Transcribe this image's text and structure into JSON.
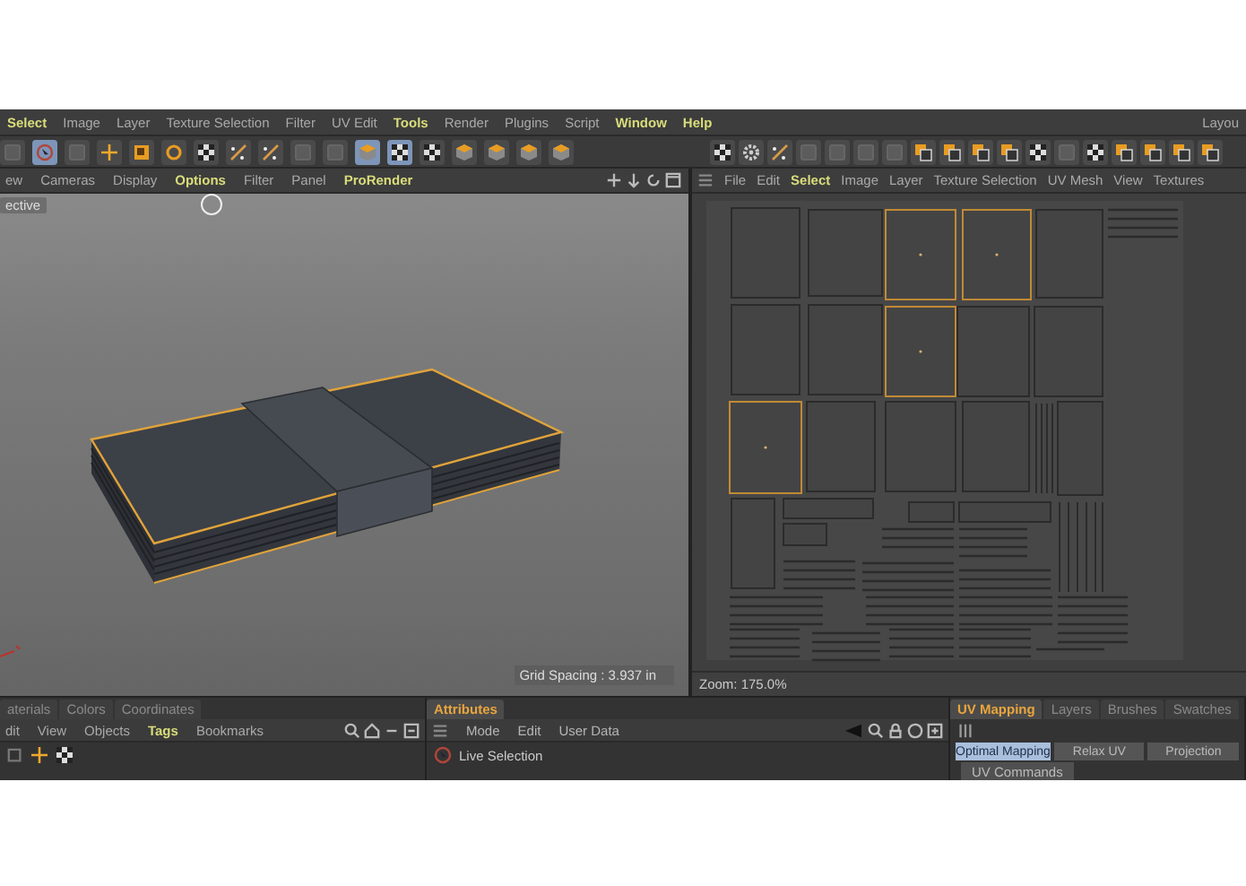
{
  "menu_bar": {
    "items": [
      {
        "label": "Select",
        "highlighted": true
      },
      {
        "label": "Image",
        "highlighted": false
      },
      {
        "label": "Layer",
        "highlighted": false
      },
      {
        "label": "Texture Selection",
        "highlighted": false
      },
      {
        "label": "Filter",
        "highlighted": false
      },
      {
        "label": "UV Edit",
        "highlighted": false
      },
      {
        "label": "Tools",
        "highlighted": true
      },
      {
        "label": "Render",
        "highlighted": false
      },
      {
        "label": "Plugins",
        "highlighted": false
      },
      {
        "label": "Script",
        "highlighted": false
      },
      {
        "label": "Window",
        "highlighted": true
      },
      {
        "label": "Help",
        "highlighted": true
      }
    ],
    "layout_label": "Layou"
  },
  "toolbar": {
    "left": [
      {
        "kind": "grey",
        "active": false
      },
      {
        "kind": "cursor",
        "active": true
      },
      {
        "kind": "grey",
        "active": false
      },
      {
        "kind": "plus",
        "active": false
      },
      {
        "kind": "scale",
        "active": false
      },
      {
        "kind": "rotate",
        "active": false
      },
      {
        "kind": "checker",
        "active": false
      },
      {
        "kind": "pen",
        "active": false
      },
      {
        "kind": "pen",
        "active": false
      },
      {
        "kind": "grey",
        "active": false
      },
      {
        "kind": "grey",
        "active": false
      },
      {
        "kind": "cube",
        "active": true
      },
      {
        "kind": "checker",
        "active": true
      },
      {
        "kind": "checker",
        "active": false
      },
      {
        "kind": "cube",
        "active": false
      },
      {
        "kind": "cube",
        "active": false
      },
      {
        "kind": "cube",
        "active": false
      },
      {
        "kind": "cube",
        "active": false
      }
    ],
    "right": [
      {
        "kind": "checker",
        "active": false
      },
      {
        "kind": "gear",
        "active": false
      },
      {
        "kind": "pen",
        "active": false
      },
      {
        "kind": "grey",
        "active": false
      },
      {
        "kind": "grey",
        "active": false
      },
      {
        "kind": "grey",
        "active": false
      },
      {
        "kind": "grey",
        "active": false
      },
      {
        "kind": "squares",
        "active": false
      },
      {
        "kind": "squares",
        "active": false
      },
      {
        "kind": "squares",
        "active": false
      },
      {
        "kind": "squares",
        "active": false
      },
      {
        "kind": "checker",
        "active": false
      },
      {
        "kind": "grey",
        "active": false
      },
      {
        "kind": "checker",
        "active": false
      },
      {
        "kind": "squares",
        "active": false
      },
      {
        "kind": "squares",
        "active": false
      },
      {
        "kind": "squares",
        "active": false
      },
      {
        "kind": "squares",
        "active": false
      }
    ]
  },
  "viewport": {
    "menu": [
      {
        "label": "ew",
        "highlighted": false
      },
      {
        "label": "Cameras",
        "highlighted": false
      },
      {
        "label": "Display",
        "highlighted": false
      },
      {
        "label": "Options",
        "highlighted": true
      },
      {
        "label": "Filter",
        "highlighted": false
      },
      {
        "label": "Panel",
        "highlighted": false
      },
      {
        "label": "ProRender",
        "highlighted": true
      }
    ],
    "camera_label": "ective",
    "grid_spacing": "Grid Spacing : 3.937 in"
  },
  "uv_editor": {
    "menu": [
      {
        "label": "File",
        "highlighted": false
      },
      {
        "label": "Edit",
        "highlighted": false
      },
      {
        "label": "Select",
        "highlighted": true
      },
      {
        "label": "Image",
        "highlighted": false
      },
      {
        "label": "Layer",
        "highlighted": false
      },
      {
        "label": "Texture Selection",
        "highlighted": false
      },
      {
        "label": "UV Mesh",
        "highlighted": false
      },
      {
        "label": "View",
        "highlighted": false
      },
      {
        "label": "Textures",
        "highlighted": false
      }
    ],
    "zoom": "Zoom: 175.0%"
  },
  "objects_panel": {
    "tabs": [
      {
        "label": "aterials",
        "selected": false
      },
      {
        "label": "Colors",
        "selected": false
      },
      {
        "label": "Coordinates",
        "selected": false
      }
    ],
    "menu": [
      {
        "label": "dit",
        "highlighted": false
      },
      {
        "label": "View",
        "highlighted": false
      },
      {
        "label": "Objects",
        "highlighted": false
      },
      {
        "label": "Tags",
        "highlighted": true
      },
      {
        "label": "Bookmarks",
        "highlighted": false
      }
    ]
  },
  "attributes_panel": {
    "tabs": [
      {
        "label": "Attributes",
        "selected": true
      }
    ],
    "menu": [
      "Mode",
      "Edit",
      "User Data"
    ],
    "tool": "Live Selection"
  },
  "uv_panel": {
    "tabs": [
      {
        "label": "UV Mapping",
        "selected": true
      },
      {
        "label": "Layers",
        "selected": false
      },
      {
        "label": "Brushes",
        "selected": false
      },
      {
        "label": "Swatches",
        "selected": false
      }
    ],
    "buttons": [
      {
        "label": "Optimal Mapping",
        "selected": true
      },
      {
        "label": "Relax UV",
        "selected": false
      },
      {
        "label": "Projection",
        "selected": false
      }
    ],
    "commands_tab": "UV Commands"
  }
}
